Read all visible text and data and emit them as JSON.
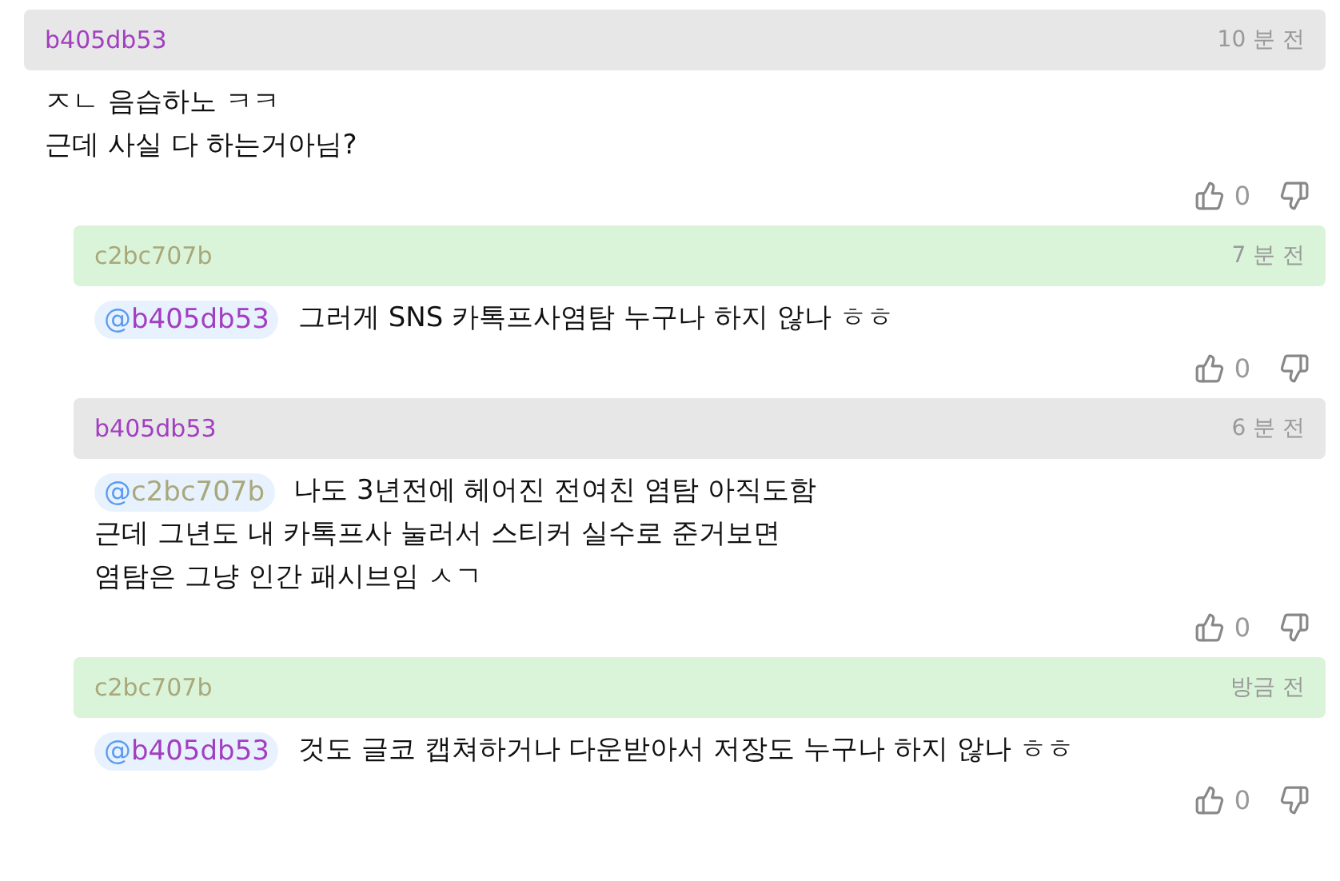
{
  "comments": [
    {
      "kind": "op",
      "author": "b405db53",
      "color": "#a23fc1",
      "time": "10 분 전",
      "text": "ㅈㄴ 음습하노 ㅋㅋ\n근데 사실 다 하는거아님?",
      "likes": "0",
      "children": [
        {
          "kind": "reply",
          "author": "c2bc707b",
          "color": "#a8a87a",
          "time": "7 분 전",
          "mention": {
            "handle": "@b405db53",
            "color": "#a23fc1"
          },
          "text": "그러게 SNS 카톡프사염탐 누구나 하지 않나 ㅎㅎ",
          "likes": "0"
        },
        {
          "kind": "op",
          "author": "b405db53",
          "color": "#a23fc1",
          "time": "6 분 전",
          "mention": {
            "handle": "@c2bc707b",
            "color": "#a8a87a"
          },
          "text": "나도 3년전에 헤어진 전여친 염탐 아직도함\n근데 그년도 내 카톡프사 눌러서 스티커 실수로 준거보면\n염탐은 그냥 인간 패시브임 ㅅㄱ",
          "likes": "0"
        },
        {
          "kind": "reply",
          "author": "c2bc707b",
          "color": "#a8a87a",
          "time": "방금 전",
          "mention": {
            "handle": "@b405db53",
            "color": "#a23fc1"
          },
          "text": "것도 글코 캡쳐하거나 다운받아서 저장도 누구나 하지 않나 ㅎㅎ",
          "likes": "0"
        }
      ]
    }
  ]
}
